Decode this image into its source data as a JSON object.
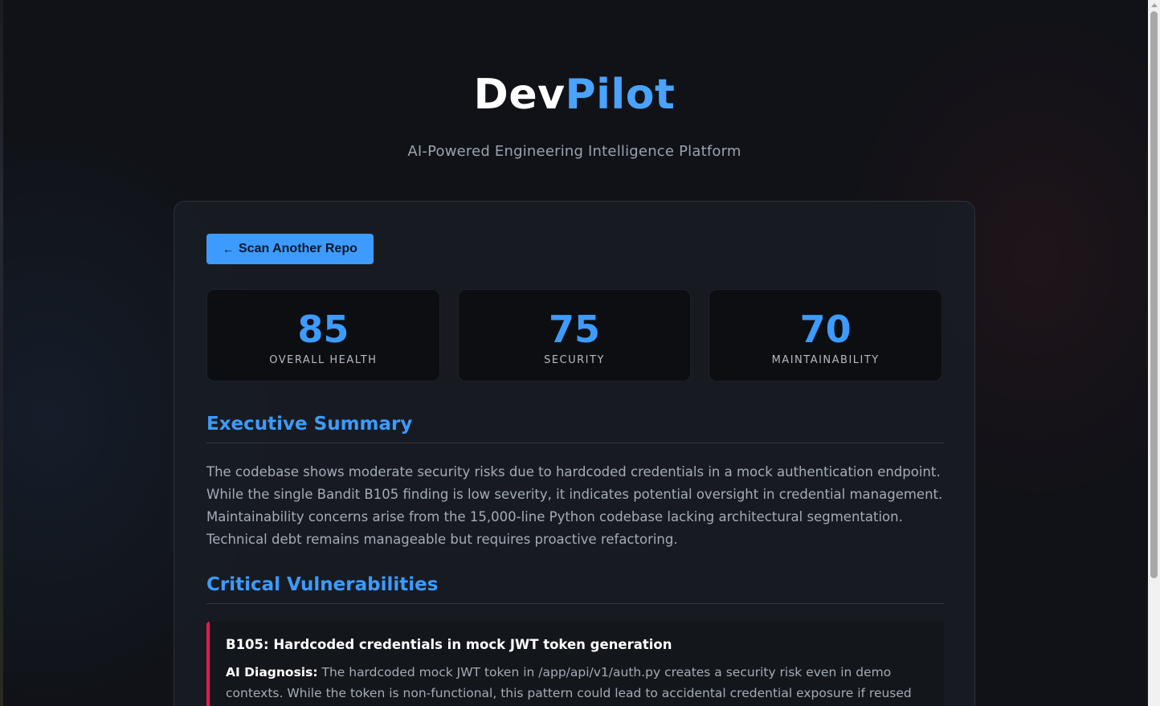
{
  "header": {
    "brand_part1": "Dev",
    "brand_part2": "Pilot",
    "tagline": "AI-Powered Engineering Intelligence Platform"
  },
  "actions": {
    "back_arrow": "←",
    "back_label": "Scan Another Repo"
  },
  "metrics": [
    {
      "value": "85",
      "label": "OVERALL HEALTH"
    },
    {
      "value": "75",
      "label": "SECURITY"
    },
    {
      "value": "70",
      "label": "MAINTAINABILITY"
    }
  ],
  "summary": {
    "title": "Executive Summary",
    "text": "The codebase shows moderate security risks due to hardcoded credentials in a mock authentication endpoint. While the single Bandit B105 finding is low severity, it indicates potential oversight in credential management. Maintainability concerns arise from the 15,000-line Python codebase lacking architectural segmentation. Technical debt remains manageable but requires proactive refactoring."
  },
  "vulnerabilities": {
    "title": "Critical Vulnerabilities",
    "items": [
      {
        "heading": "B105: Hardcoded credentials in mock JWT token generation",
        "diagnosis_label": "AI Diagnosis:",
        "diagnosis_text": "The hardcoded mock JWT token in /app/api/v1/auth.py creates a security risk even in demo contexts. While the token is non-functional, this pattern could lead to accidental credential exposure if reused in production code."
      }
    ]
  },
  "colors": {
    "accent": "#3d9bff",
    "critical": "#e8174f",
    "background": "#101217"
  }
}
